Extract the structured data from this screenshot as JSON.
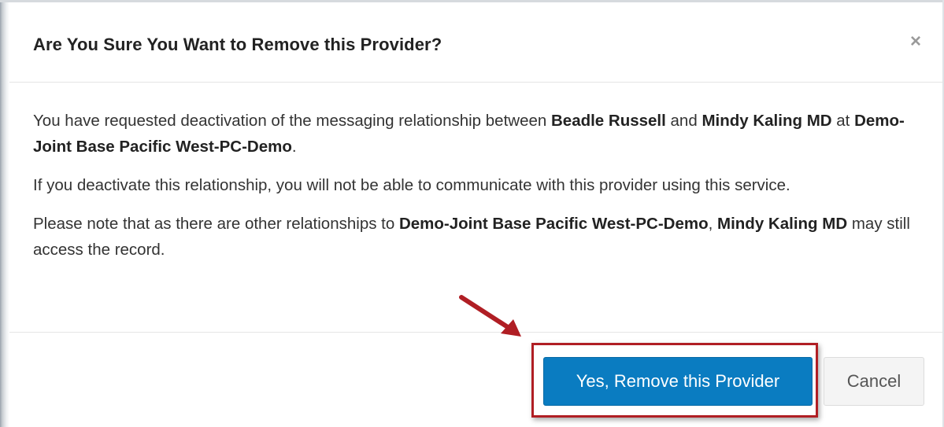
{
  "dialog": {
    "title": "Are You Sure You Want to Remove this Provider?",
    "close_glyph": "×",
    "paragraph1": {
      "t1": "You have requested deactivation of the messaging relationship between ",
      "patient": "Beadle Russell",
      "t2": " and ",
      "provider": "Mindy Kaling MD",
      "t3": " at ",
      "location": "Demo-Joint Base Pacific West-PC-Demo",
      "t4": "."
    },
    "paragraph2": "If you deactivate this relationship, you will not be able to communicate with this provider using this service.",
    "paragraph3": {
      "t1": "Please note that as there are other relationships to ",
      "location": "Demo-Joint Base Pacific West-PC-Demo",
      "t2": ", ",
      "provider": "Mindy Kaling MD",
      "t3": " may still access the record."
    },
    "confirm_label": "Yes, Remove this Provider",
    "cancel_label": "Cancel"
  },
  "colors": {
    "primary": "#0a7cc1",
    "annotation_red": "#b01e24"
  },
  "icons": {
    "close": "close-icon",
    "annotation": "red-arrow-icon"
  }
}
